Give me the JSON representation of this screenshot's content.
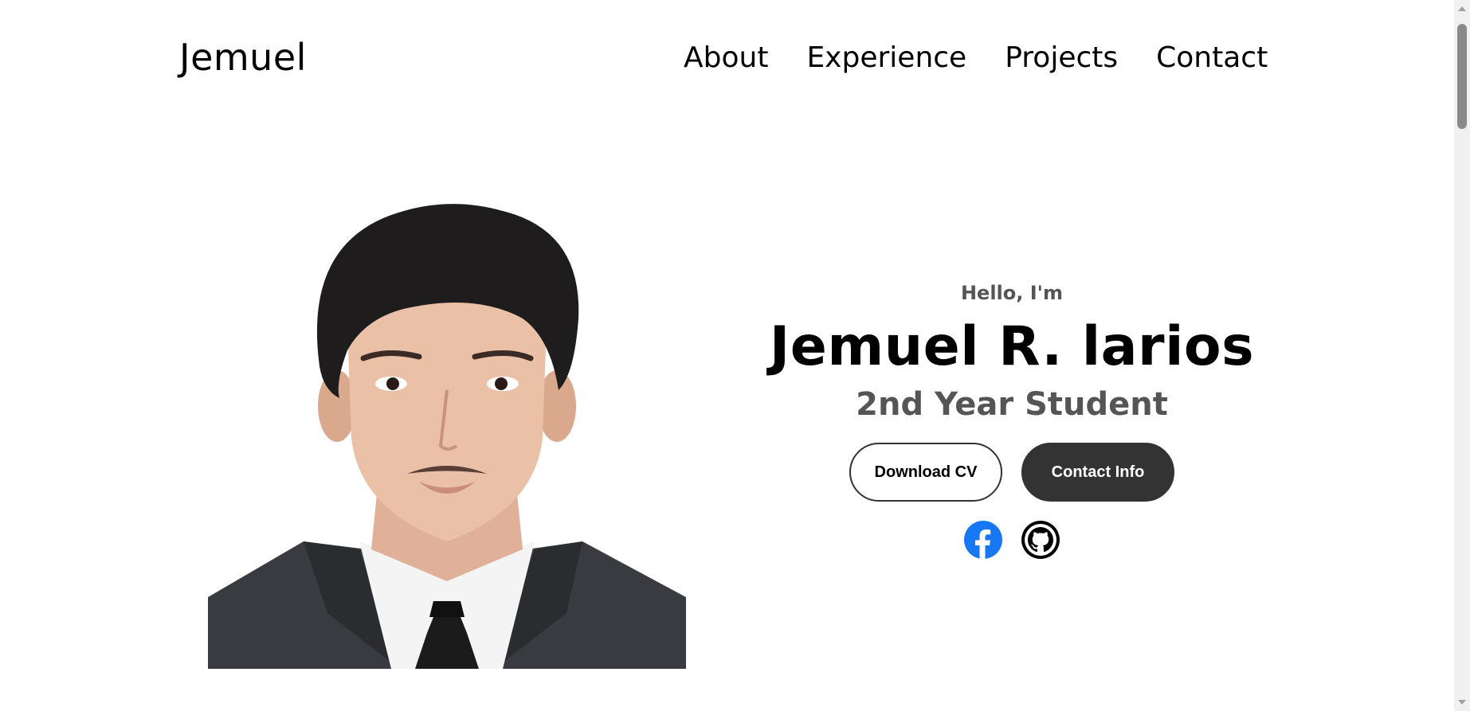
{
  "header": {
    "logo": "Jemuel",
    "nav": [
      {
        "label": "About"
      },
      {
        "label": "Experience"
      },
      {
        "label": "Projects"
      },
      {
        "label": "Contact"
      }
    ]
  },
  "hero": {
    "greeting": "Hello, I'm",
    "name": "Jemuel R. larios",
    "role": "2nd Year Student",
    "buttons": {
      "download_cv": "Download CV",
      "contact_info": "Contact Info"
    },
    "socials": [
      {
        "icon": "facebook-icon"
      },
      {
        "icon": "github-icon"
      }
    ]
  },
  "colors": {
    "background": "#ffffff",
    "text": "#000000",
    "muted": "#555555",
    "button_dark": "#333333",
    "facebook": "#1877f2"
  }
}
